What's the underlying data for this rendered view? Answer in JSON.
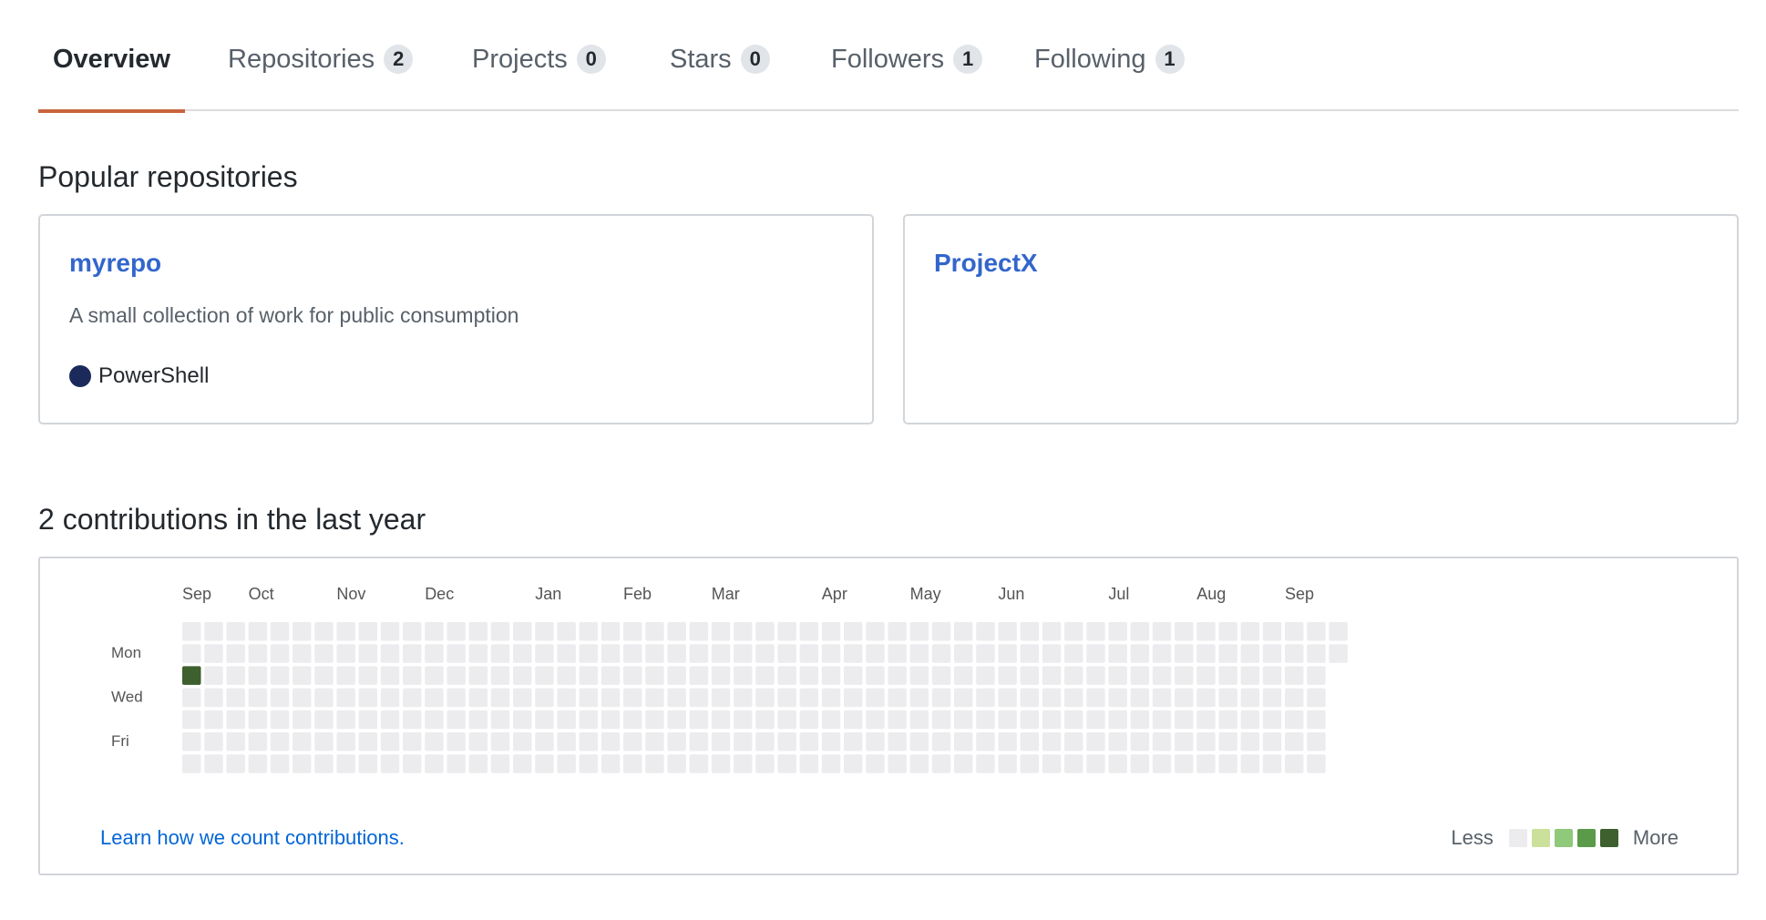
{
  "tabs": [
    {
      "label": "Overview",
      "count": null,
      "active": true
    },
    {
      "label": "Repositories",
      "count": "2",
      "active": false
    },
    {
      "label": "Projects",
      "count": "0",
      "active": false
    },
    {
      "label": "Stars",
      "count": "0",
      "active": false
    },
    {
      "label": "Followers",
      "count": "1",
      "active": false
    },
    {
      "label": "Following",
      "count": "1",
      "active": false
    }
  ],
  "popular": {
    "title": "Popular repositories",
    "repos": [
      {
        "name": "myrepo",
        "description": "A small collection of work for public consumption",
        "language": "PowerShell",
        "language_color": "#1b2a5a"
      },
      {
        "name": "ProjectX",
        "description": "",
        "language": "",
        "language_color": ""
      }
    ]
  },
  "contributions": {
    "title": "2 contributions in the last year",
    "months": [
      "Sep",
      "Oct",
      "Nov",
      "Dec",
      "Jan",
      "Feb",
      "Mar",
      "Apr",
      "May",
      "Jun",
      "Jul",
      "Aug",
      "Sep"
    ],
    "month_start_week": [
      0,
      3,
      7,
      11,
      16,
      20,
      24,
      29,
      33,
      37,
      42,
      46,
      50
    ],
    "day_labels": [
      "",
      "Mon",
      "",
      "Wed",
      "",
      "Fri",
      ""
    ],
    "weeks": 53,
    "last_week_days": 2,
    "active_cells": [
      {
        "week": 0,
        "day": 2,
        "level": 4
      }
    ],
    "level_colors": [
      "#ebedf0",
      "#c6e48b",
      "#7bc96f",
      "#239a3b",
      "#196127"
    ],
    "observed_level_colors": [
      "#ececee",
      "#cbe09a",
      "#8fc97a",
      "#5a9a48",
      "#3e5f2e"
    ],
    "learn_link": "Learn how we count contributions.",
    "legend_less": "Less",
    "legend_more": "More"
  }
}
